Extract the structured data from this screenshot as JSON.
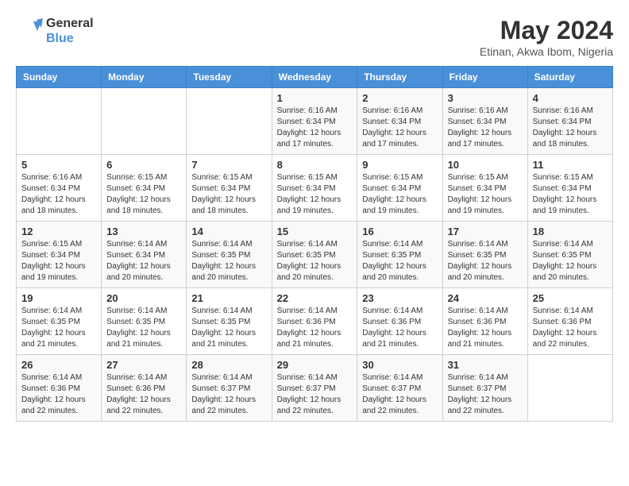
{
  "logo": {
    "line1": "General",
    "line2": "Blue"
  },
  "title": "May 2024",
  "subtitle": "Etinan, Akwa Ibom, Nigeria",
  "days_of_week": [
    "Sunday",
    "Monday",
    "Tuesday",
    "Wednesday",
    "Thursday",
    "Friday",
    "Saturday"
  ],
  "weeks": [
    [
      {
        "day": "",
        "info": ""
      },
      {
        "day": "",
        "info": ""
      },
      {
        "day": "",
        "info": ""
      },
      {
        "day": "1",
        "info": "Sunrise: 6:16 AM\nSunset: 6:34 PM\nDaylight: 12 hours and 17 minutes."
      },
      {
        "day": "2",
        "info": "Sunrise: 6:16 AM\nSunset: 6:34 PM\nDaylight: 12 hours and 17 minutes."
      },
      {
        "day": "3",
        "info": "Sunrise: 6:16 AM\nSunset: 6:34 PM\nDaylight: 12 hours and 17 minutes."
      },
      {
        "day": "4",
        "info": "Sunrise: 6:16 AM\nSunset: 6:34 PM\nDaylight: 12 hours and 18 minutes."
      }
    ],
    [
      {
        "day": "5",
        "info": "Sunrise: 6:16 AM\nSunset: 6:34 PM\nDaylight: 12 hours and 18 minutes."
      },
      {
        "day": "6",
        "info": "Sunrise: 6:15 AM\nSunset: 6:34 PM\nDaylight: 12 hours and 18 minutes."
      },
      {
        "day": "7",
        "info": "Sunrise: 6:15 AM\nSunset: 6:34 PM\nDaylight: 12 hours and 18 minutes."
      },
      {
        "day": "8",
        "info": "Sunrise: 6:15 AM\nSunset: 6:34 PM\nDaylight: 12 hours and 19 minutes."
      },
      {
        "day": "9",
        "info": "Sunrise: 6:15 AM\nSunset: 6:34 PM\nDaylight: 12 hours and 19 minutes."
      },
      {
        "day": "10",
        "info": "Sunrise: 6:15 AM\nSunset: 6:34 PM\nDaylight: 12 hours and 19 minutes."
      },
      {
        "day": "11",
        "info": "Sunrise: 6:15 AM\nSunset: 6:34 PM\nDaylight: 12 hours and 19 minutes."
      }
    ],
    [
      {
        "day": "12",
        "info": "Sunrise: 6:15 AM\nSunset: 6:34 PM\nDaylight: 12 hours and 19 minutes."
      },
      {
        "day": "13",
        "info": "Sunrise: 6:14 AM\nSunset: 6:34 PM\nDaylight: 12 hours and 20 minutes."
      },
      {
        "day": "14",
        "info": "Sunrise: 6:14 AM\nSunset: 6:35 PM\nDaylight: 12 hours and 20 minutes."
      },
      {
        "day": "15",
        "info": "Sunrise: 6:14 AM\nSunset: 6:35 PM\nDaylight: 12 hours and 20 minutes."
      },
      {
        "day": "16",
        "info": "Sunrise: 6:14 AM\nSunset: 6:35 PM\nDaylight: 12 hours and 20 minutes."
      },
      {
        "day": "17",
        "info": "Sunrise: 6:14 AM\nSunset: 6:35 PM\nDaylight: 12 hours and 20 minutes."
      },
      {
        "day": "18",
        "info": "Sunrise: 6:14 AM\nSunset: 6:35 PM\nDaylight: 12 hours and 20 minutes."
      }
    ],
    [
      {
        "day": "19",
        "info": "Sunrise: 6:14 AM\nSunset: 6:35 PM\nDaylight: 12 hours and 21 minutes."
      },
      {
        "day": "20",
        "info": "Sunrise: 6:14 AM\nSunset: 6:35 PM\nDaylight: 12 hours and 21 minutes."
      },
      {
        "day": "21",
        "info": "Sunrise: 6:14 AM\nSunset: 6:35 PM\nDaylight: 12 hours and 21 minutes."
      },
      {
        "day": "22",
        "info": "Sunrise: 6:14 AM\nSunset: 6:36 PM\nDaylight: 12 hours and 21 minutes."
      },
      {
        "day": "23",
        "info": "Sunrise: 6:14 AM\nSunset: 6:36 PM\nDaylight: 12 hours and 21 minutes."
      },
      {
        "day": "24",
        "info": "Sunrise: 6:14 AM\nSunset: 6:36 PM\nDaylight: 12 hours and 21 minutes."
      },
      {
        "day": "25",
        "info": "Sunrise: 6:14 AM\nSunset: 6:36 PM\nDaylight: 12 hours and 22 minutes."
      }
    ],
    [
      {
        "day": "26",
        "info": "Sunrise: 6:14 AM\nSunset: 6:36 PM\nDaylight: 12 hours and 22 minutes."
      },
      {
        "day": "27",
        "info": "Sunrise: 6:14 AM\nSunset: 6:36 PM\nDaylight: 12 hours and 22 minutes."
      },
      {
        "day": "28",
        "info": "Sunrise: 6:14 AM\nSunset: 6:37 PM\nDaylight: 12 hours and 22 minutes."
      },
      {
        "day": "29",
        "info": "Sunrise: 6:14 AM\nSunset: 6:37 PM\nDaylight: 12 hours and 22 minutes."
      },
      {
        "day": "30",
        "info": "Sunrise: 6:14 AM\nSunset: 6:37 PM\nDaylight: 12 hours and 22 minutes."
      },
      {
        "day": "31",
        "info": "Sunrise: 6:14 AM\nSunset: 6:37 PM\nDaylight: 12 hours and 22 minutes."
      },
      {
        "day": "",
        "info": ""
      }
    ]
  ]
}
